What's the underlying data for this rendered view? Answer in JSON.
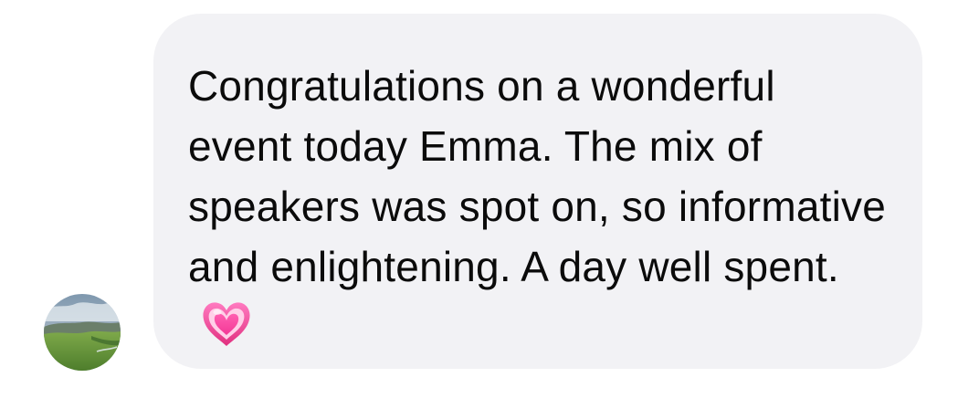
{
  "message": {
    "text": "Congratulations on a wonderful event today Emma. The mix of speakers was spot on, so informative and enlightening. A day well spent.",
    "emoji": "heart-icon"
  },
  "avatar": {
    "icon": "landscape-avatar-icon"
  },
  "colors": {
    "bubble_bg": "#f2f2f5",
    "text": "#0b0b0b",
    "heart_pink": "#f05aa6"
  }
}
